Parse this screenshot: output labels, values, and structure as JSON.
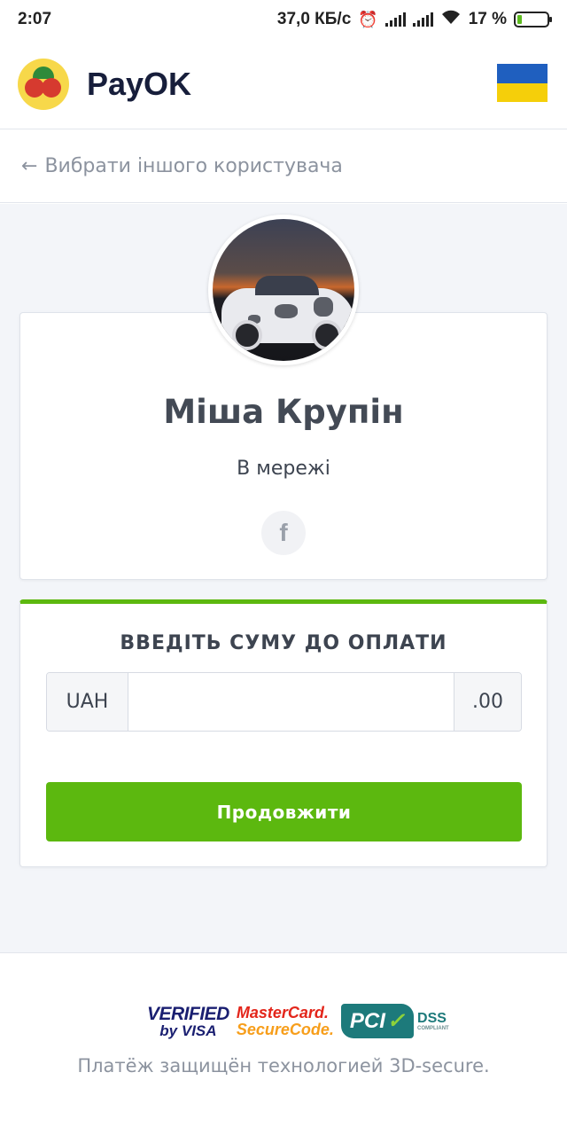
{
  "status_bar": {
    "time": "2:07",
    "speed": "37,0 КБ/с",
    "battery": "17 %",
    "icons": [
      "alarm-icon",
      "signal-icon",
      "signal-icon",
      "wifi-icon",
      "battery-charging-icon"
    ]
  },
  "header": {
    "brand": "PayOK",
    "logo_icon": "raspberry-logo",
    "flag_icon": "ukraine-flag-icon",
    "flag_colors": [
      "#1f5fbf",
      "#f5cf0a"
    ]
  },
  "back_link": {
    "icon": "arrow-left-icon",
    "label": "Вибрати іншого користувача"
  },
  "profile": {
    "avatar": "avatar-car-photo",
    "name": "Міша Крупін",
    "status": "В мережі",
    "social_icon": "facebook-icon",
    "social_glyph": "f"
  },
  "payment": {
    "title": "ВВЕДІТЬ СУМУ ДО ОПЛАТИ",
    "currency": "UAH",
    "amount_value": "",
    "decimals": ".00",
    "continue_label": "Продовжити",
    "accent_color": "#5cb80f"
  },
  "footer": {
    "badges": {
      "visa_line1": "VERIFIED",
      "visa_line2": "by VISA",
      "mc_line1": "MasterCard.",
      "mc_line2": "SecureCode.",
      "pci_text": "PCI",
      "dss_text": "DSS",
      "dss_small": "COMPLIANT"
    },
    "secure_text": "Платёж защищён технологией 3D-secure."
  }
}
